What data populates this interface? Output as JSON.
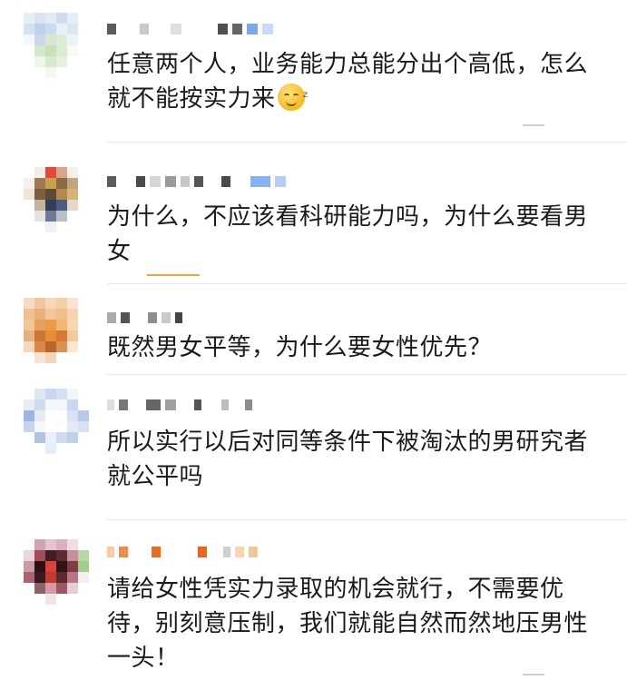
{
  "comments": [
    {
      "text": "任意两个人，业务能力总能分出个高低，怎么就不能按实力来",
      "emoji": "zzz-sleepy-face-icon"
    },
    {
      "text": "为什么，不应该看科研能力吗，为什么要看男女"
    },
    {
      "text": "既然男女平等，为什么要女性优先？"
    },
    {
      "text": "所以实行以后对同等条件下被淘汰的男研究者就公平吗"
    },
    {
      "text": "请给女性凭实力录取的机会就行，不需要优待，别刻意压制，我们就能自然而然地压男性一头！"
    }
  ],
  "colors": {
    "text": "#1a1a1a",
    "divider": "#e9e9e9",
    "accent_underline": "#f0a33c"
  }
}
